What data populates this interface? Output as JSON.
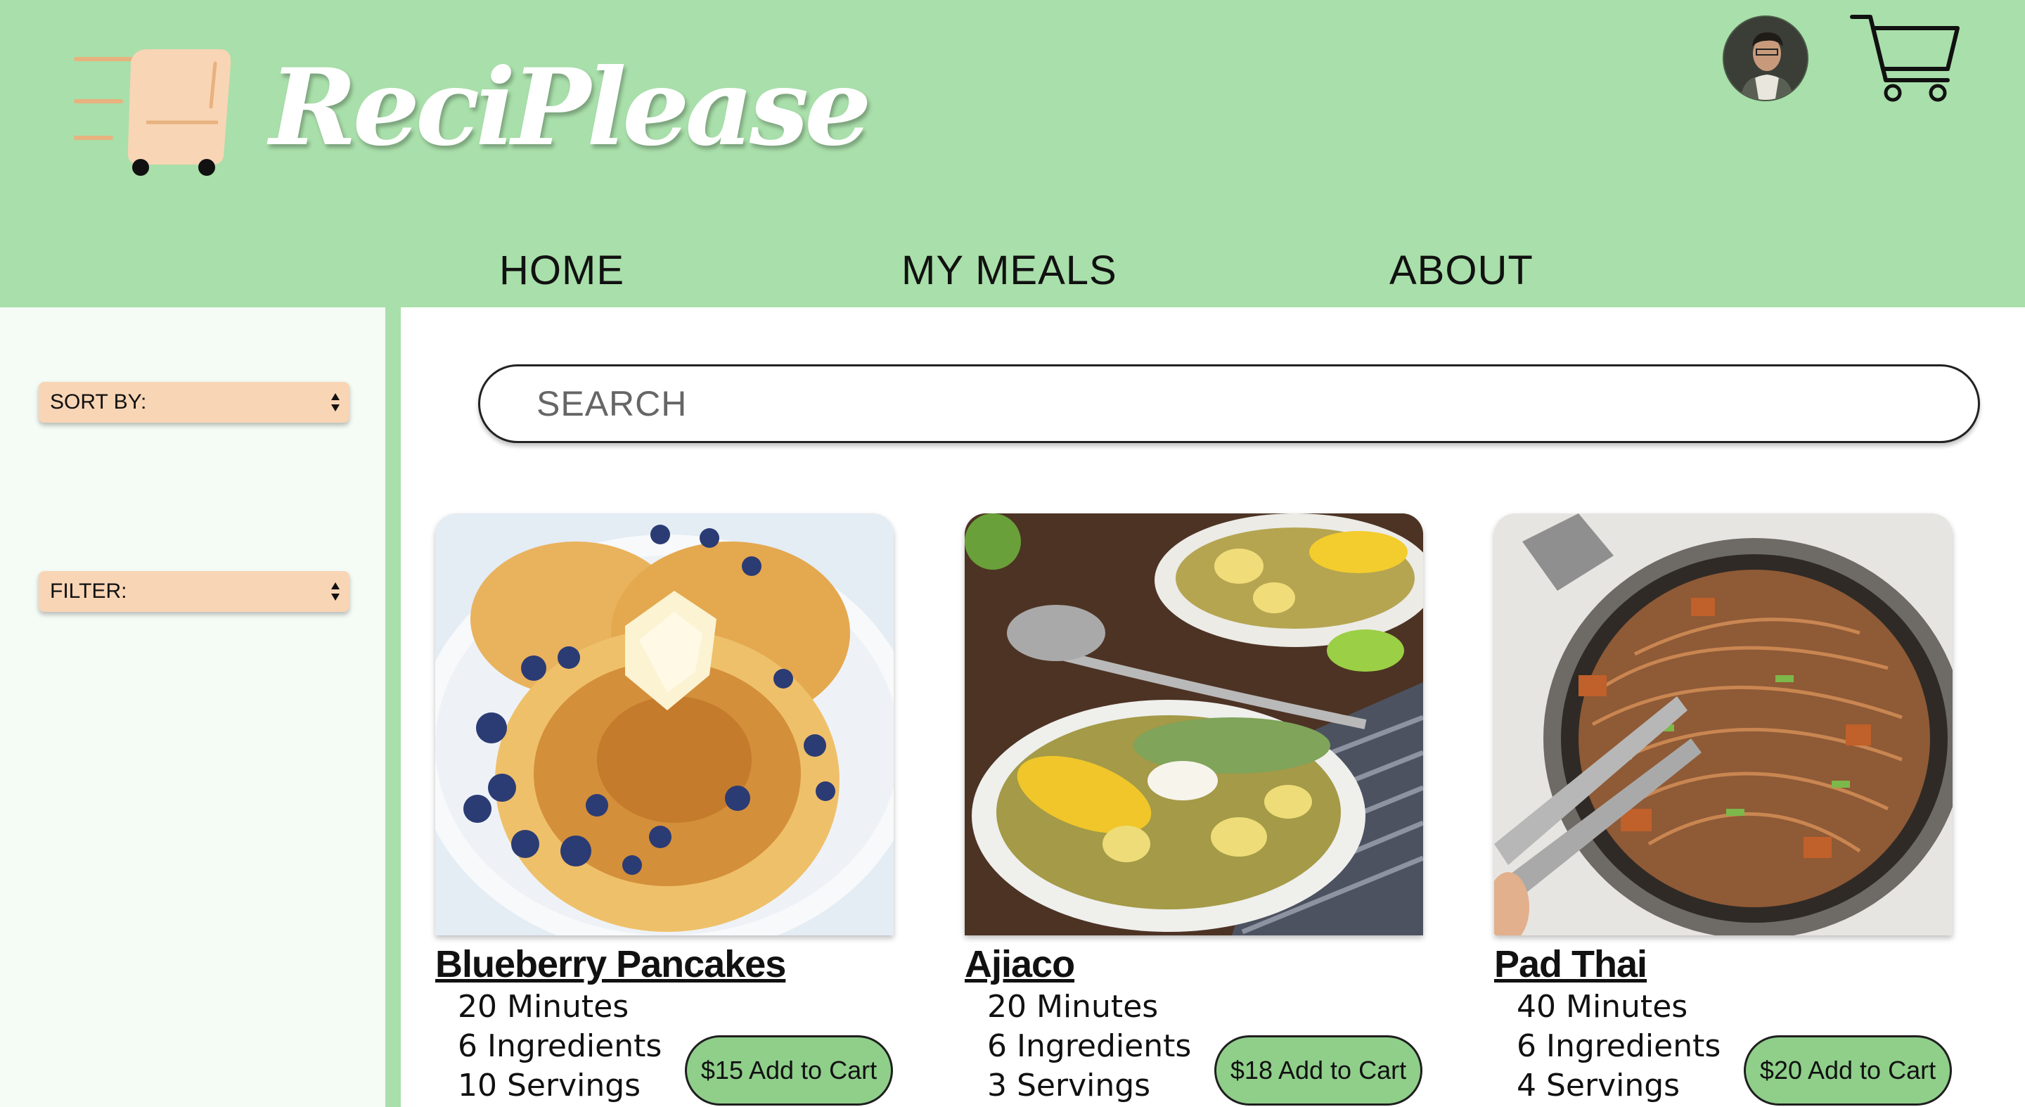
{
  "brand": {
    "name": "ReciPlease"
  },
  "nav": {
    "home": "HOME",
    "my_meals": "MY MEALS",
    "about": "ABOUT"
  },
  "sidebar": {
    "sort_label": "SORT BY:",
    "filter_label": "FILTER:"
  },
  "search": {
    "placeholder": "SEARCH"
  },
  "colors": {
    "header_bg": "#a9dfaa",
    "sidebar_bg": "#f5fbf5",
    "select_bg": "#f8d5b5",
    "button_bg": "#8fcf8a",
    "logo_peach": "#f8d5b5"
  },
  "icons": {
    "logo": "cart-logo-icon",
    "avatar": "user-avatar",
    "cart": "shopping-cart-icon"
  },
  "recipes": [
    {
      "title": "Blueberry Pancakes",
      "time": "20 Minutes",
      "ingredients": "6 Ingredients",
      "servings": "10 Servings",
      "button": "$15 Add to Cart"
    },
    {
      "title": "Ajiaco",
      "time": "20 Minutes",
      "ingredients": "6 Ingredients",
      "servings": "3 Servings",
      "button": "$18 Add to Cart"
    },
    {
      "title": "Pad Thai",
      "time": "40 Minutes",
      "ingredients": "6 Ingredients",
      "servings": "4 Servings",
      "button": "$20 Add to Cart"
    }
  ]
}
